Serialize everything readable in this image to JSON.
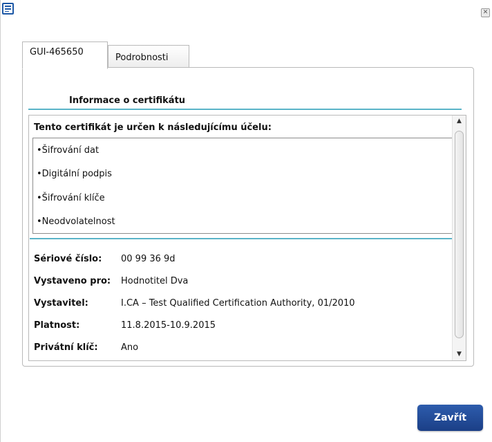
{
  "titlebar": {
    "app_icon": "document-window-icon",
    "close_glyph": "✕"
  },
  "tabs": [
    {
      "label": "GUI-465650",
      "active": true
    },
    {
      "label": "Podrobnosti",
      "active": false
    }
  ],
  "panel": {
    "section_title": "Informace o certifikátu",
    "purpose_heading": "Tento certifikát je určen k následujícímu účelu:",
    "purposes": [
      "•Šifrování dat",
      "•Digitální podpis",
      "•Šifrování klíče",
      "•Neodvolatelnost"
    ],
    "details": [
      {
        "label": "Sériové číslo:",
        "value": "00 99 36 9d"
      },
      {
        "label": "Vystaveno pro:",
        "value": "Hodnotitel Dva"
      },
      {
        "label": "Vystavitel:",
        "value": "I.CA – Test Qualified Certification Authority, 01/2010"
      },
      {
        "label": "Platnost:",
        "value": "11.8.2015-10.9.2015"
      },
      {
        "label": "Privátní klíč:",
        "value": "Ano"
      }
    ]
  },
  "scrollbar": {
    "up_glyph": "▲",
    "down_glyph": "▼"
  },
  "footer": {
    "close_label": "Zavřít"
  },
  "colors": {
    "accent_line": "#5ab4c8",
    "button_blue": "#1b3f87",
    "icon_blue": "#1d58a6"
  }
}
